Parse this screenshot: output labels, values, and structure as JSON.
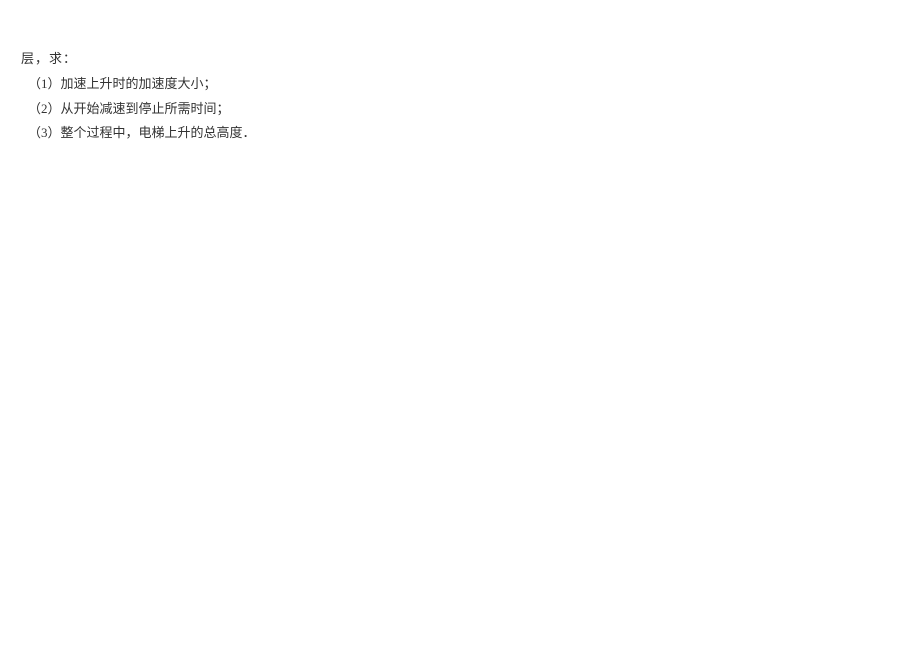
{
  "problem": {
    "intro": "层，求：",
    "item1": "（1）加速上升时的加速度大小；",
    "item2": "（2）从开始减速到停止所需时间；",
    "item3": "（3）整个过程中，电梯上升的总高度．"
  }
}
